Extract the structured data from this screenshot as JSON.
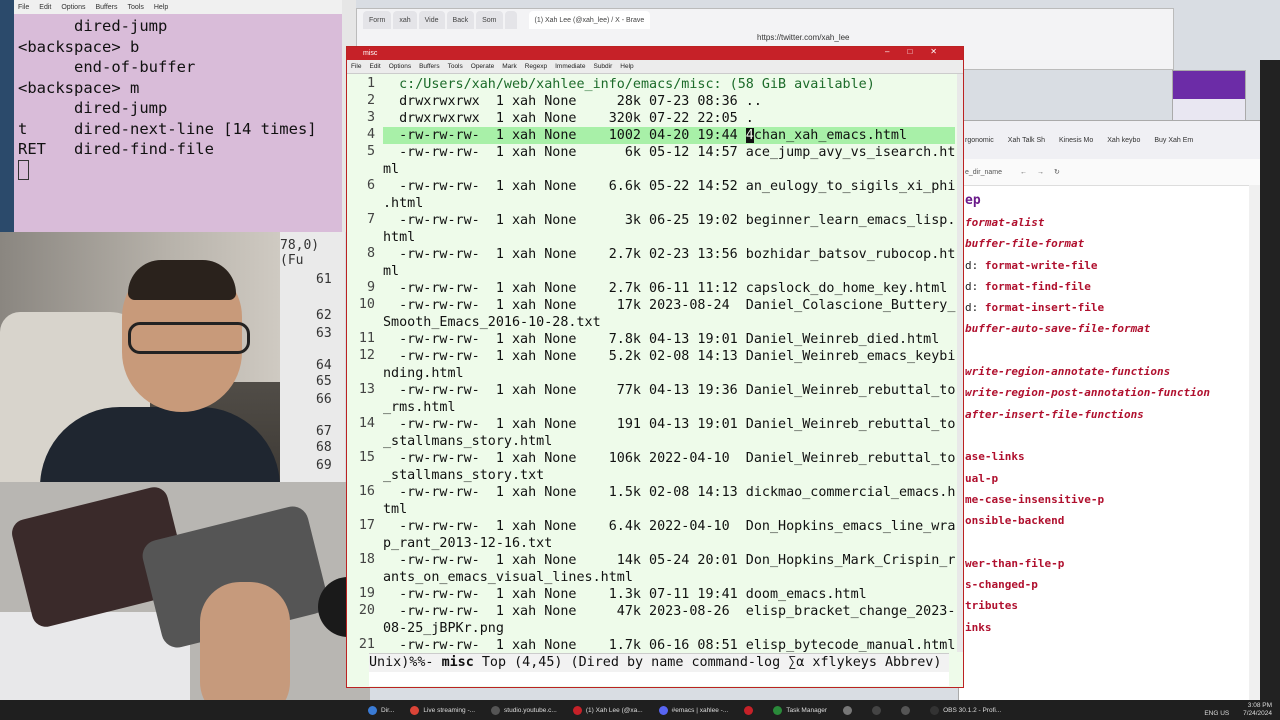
{
  "keylog": {
    "menu": [
      "File",
      "Edit",
      "Options",
      "Buffers",
      "Tools",
      "Help"
    ],
    "lines": [
      "      dired-jump",
      "<backspace> b",
      "      end-of-buffer",
      "<backspace> m",
      "      dired-jump",
      "t     dired-next-line [14 times]",
      "RET   dired-find-file"
    ]
  },
  "webcam_side": {
    "status": "78,0) (Fu",
    "line_numbers": [
      "61",
      "62",
      "63",
      "64",
      "65",
      "66",
      "67",
      "68",
      "69"
    ]
  },
  "browser": {
    "tabs": [
      "Form",
      "xah",
      "Vide",
      "Back",
      "Som",
      "",
      "(1) Xah Lee (@xah_lee) / X - Brave"
    ],
    "url": "https://twitter.com/xah_lee"
  },
  "emacs": {
    "title": "misc",
    "menu": [
      "File",
      "Edit",
      "Options",
      "Buffers",
      "Tools",
      "Operate",
      "Mark",
      "Regexp",
      "Immediate",
      "Subdir",
      "Help"
    ],
    "lines": [
      {
        "n": "1",
        "text": "  c:/Users/xah/web/xahlee_info/emacs/misc: (58 GiB available)",
        "type": "header"
      },
      {
        "n": "2",
        "text": "  drwxrwxrwx  1 xah None     28k 07-23 08:36 .."
      },
      {
        "n": "3",
        "text": "  drwxrwxrwx  1 xah None    320k 07-22 22:05 ."
      },
      {
        "n": "4",
        "pre": "  -rw-rw-rw-  1 xah None    1002 04-20 19:44 ",
        "pt": "4",
        "post": "chan_xah_emacs.html",
        "type": "hl"
      },
      {
        "n": "5",
        "text": "  -rw-rw-rw-  1 xah None      6k 05-12 14:57 ace_jump_avy_vs_isearch.ht"
      },
      {
        "n": "",
        "text": "ml"
      },
      {
        "n": "6",
        "text": "  -rw-rw-rw-  1 xah None    6.6k 05-22 14:52 an_eulogy_to_sigils_xi_phi"
      },
      {
        "n": "",
        "text": ".html"
      },
      {
        "n": "7",
        "text": "  -rw-rw-rw-  1 xah None      3k 06-25 19:02 beginner_learn_emacs_lisp."
      },
      {
        "n": "",
        "text": "html"
      },
      {
        "n": "8",
        "text": "  -rw-rw-rw-  1 xah None    2.7k 02-23 13:56 bozhidar_batsov_rubocop.ht"
      },
      {
        "n": "",
        "text": "ml"
      },
      {
        "n": "9",
        "text": "  -rw-rw-rw-  1 xah None    2.7k 06-11 11:12 capslock_do_home_key.html"
      },
      {
        "n": "10",
        "text": "  -rw-rw-rw-  1 xah None     17k 2023-08-24  Daniel_Colascione_Buttery_"
      },
      {
        "n": "",
        "text": "Smooth_Emacs_2016-10-28.txt"
      },
      {
        "n": "11",
        "text": "  -rw-rw-rw-  1 xah None    7.8k 04-13 19:01 Daniel_Weinreb_died.html"
      },
      {
        "n": "12",
        "text": "  -rw-rw-rw-  1 xah None    5.2k 02-08 14:13 Daniel_Weinreb_emacs_keybi"
      },
      {
        "n": "",
        "text": "nding.html"
      },
      {
        "n": "13",
        "text": "  -rw-rw-rw-  1 xah None     77k 04-13 19:36 Daniel_Weinreb_rebuttal_to"
      },
      {
        "n": "",
        "text": "_rms.html"
      },
      {
        "n": "14",
        "text": "  -rw-rw-rw-  1 xah None     191 04-13 19:01 Daniel_Weinreb_rebuttal_to"
      },
      {
        "n": "",
        "text": "_stallmans_story.html"
      },
      {
        "n": "15",
        "text": "  -rw-rw-rw-  1 xah None    106k 2022-04-10  Daniel_Weinreb_rebuttal_to"
      },
      {
        "n": "",
        "text": "_stallmans_story.txt"
      },
      {
        "n": "16",
        "text": "  -rw-rw-rw-  1 xah None    1.5k 02-08 14:13 dickmao_commercial_emacs.h"
      },
      {
        "n": "",
        "text": "tml"
      },
      {
        "n": "17",
        "text": "  -rw-rw-rw-  1 xah None    6.4k 2022-04-10  Don_Hopkins_emacs_line_wra"
      },
      {
        "n": "",
        "text": "p_rant_2013-12-16.txt"
      },
      {
        "n": "18",
        "text": "  -rw-rw-rw-  1 xah None     14k 05-24 20:01 Don_Hopkins_Mark_Crispin_r"
      },
      {
        "n": "",
        "text": "ants_on_emacs_visual_lines.html"
      },
      {
        "n": "19",
        "text": "  -rw-rw-rw-  1 xah None    1.3k 07-11 19:41 doom_emacs.html"
      },
      {
        "n": "20",
        "text": "  -rw-rw-rw-  1 xah None     47k 2023-08-26  elisp_bracket_change_2023-"
      },
      {
        "n": "",
        "text": "08-25_jBPKr.png"
      },
      {
        "n": "21",
        "text": "  -rw-rw-rw-  1 xah None    1.7k 06-16 08:51 elisp_bytecode_manual.html"
      }
    ],
    "modeline_pre": "Unix)%%- ",
    "modeline_buf": "misc",
    "modeline_post": " Top (4,45) (Dired by name command-log ∑α xflykeys Abbrev)"
  },
  "rightbrowser": {
    "tabs": [
      "rgonomic",
      "Xah Talk Sh",
      "Kinesis Mo",
      "Xah keybo",
      "Buy Xah Em"
    ],
    "url_fragment": "e_dir_name",
    "heading": "ep",
    "items": [
      {
        "pre": "",
        "name": "format-alist",
        "italic": true
      },
      {
        "pre": "",
        "name": "buffer-file-format",
        "italic": true
      },
      {
        "pre": "d: ",
        "name": "format-write-file",
        "italic": false
      },
      {
        "pre": "d: ",
        "name": "format-find-file",
        "italic": false
      },
      {
        "pre": "d: ",
        "name": "format-insert-file",
        "italic": false
      },
      {
        "pre": "",
        "name": "buffer-auto-save-file-format",
        "italic": true
      },
      {
        "pre": "",
        "name": "",
        "italic": false
      },
      {
        "pre": "",
        "name": "write-region-annotate-functions",
        "italic": true
      },
      {
        "pre": "",
        "name": "write-region-post-annotation-function",
        "italic": true
      },
      {
        "pre": "",
        "name": "after-insert-file-functions",
        "italic": true
      },
      {
        "pre": "",
        "name": "",
        "italic": false
      },
      {
        "pre": "",
        "name": "ase-links",
        "italic": false
      },
      {
        "pre": "",
        "name": "ual-p",
        "italic": false
      },
      {
        "pre": "",
        "name": "me-case-insensitive-p",
        "italic": false
      },
      {
        "pre": "",
        "name": "onsible-backend",
        "italic": false
      },
      {
        "pre": "",
        "name": "",
        "italic": false
      },
      {
        "pre": "",
        "name": "wer-than-file-p",
        "italic": false
      },
      {
        "pre": "",
        "name": "s-changed-p",
        "italic": false
      },
      {
        "pre": "",
        "name": "tributes",
        "italic": false
      },
      {
        "pre": "",
        "name": "inks",
        "italic": false
      }
    ]
  },
  "taskbar": {
    "items": [
      "Dir...",
      "Live streaming -...",
      "studio.youtube.c...",
      "(1) Xah Lee (@xa...",
      "#emacs | xahlee -...",
      "",
      "Task Manager",
      "",
      "",
      "",
      "OBS 30.1.2 - Profi..."
    ],
    "lang": "ENG US",
    "time": "3:08 PM",
    "date": "7/24/2024"
  },
  "colors": {
    "emacs_bg": "#eefbea",
    "emacs_title": "#c62128",
    "highlight": "#a8f0a8",
    "function_red": "#b0102e",
    "keylog_bg": "#d9bcd9"
  }
}
